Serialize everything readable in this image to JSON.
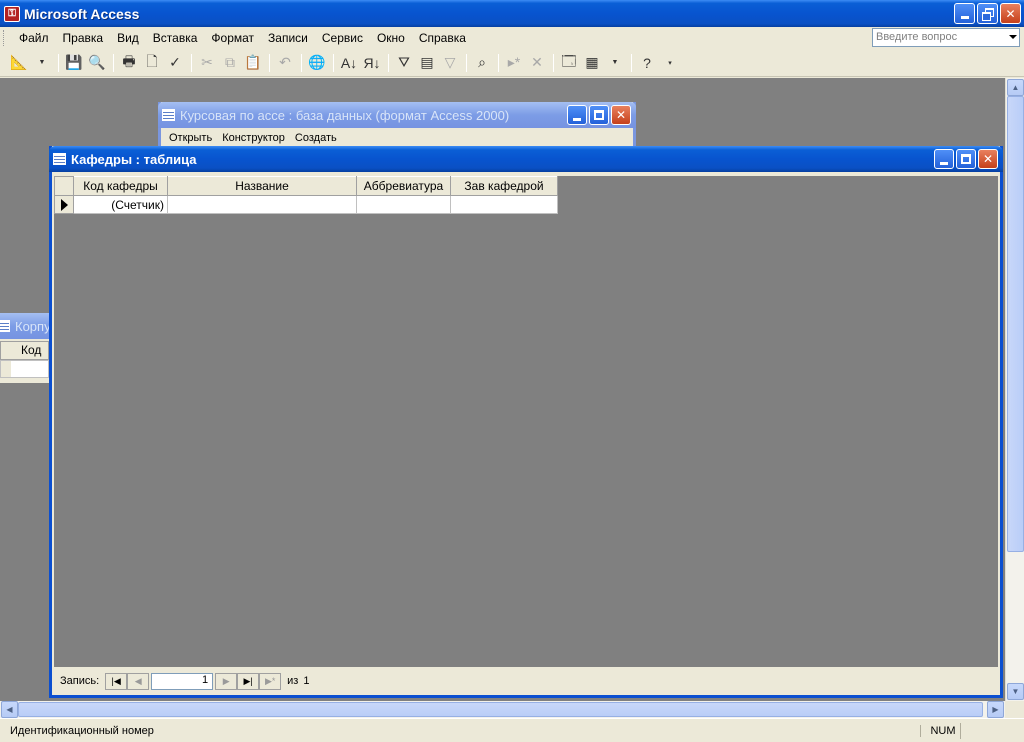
{
  "app": {
    "title": "Microsoft Access"
  },
  "menu": {
    "items": [
      "Файл",
      "Правка",
      "Вид",
      "Вставка",
      "Формат",
      "Записи",
      "Сервис",
      "Окно",
      "Справка"
    ],
    "ask_placeholder": "Введите вопрос"
  },
  "db_window": {
    "title": "Курсовая по ассе : база данных (формат Access 2000)",
    "toolbar": {
      "open": "Открыть",
      "design": "Конструктор",
      "create": "Создать"
    }
  },
  "table_window": {
    "title": "Кафедры : таблица",
    "columns": [
      "Код кафедры",
      "Название",
      "Аббревиатура",
      "Зав кафедрой"
    ],
    "new_row": [
      "(Счетчик)",
      "",
      "",
      ""
    ],
    "nav": {
      "label": "Запись:",
      "current": "1",
      "of_label": "из",
      "total": "1"
    }
  },
  "bg_window": {
    "title": "Корпу",
    "column": "Код"
  },
  "status": {
    "text": "Идентификационный номер",
    "num": "NUM"
  },
  "colors": {
    "titlebar": "#0854cf",
    "mdi_bg": "#808080",
    "face": "#ece9d8"
  }
}
